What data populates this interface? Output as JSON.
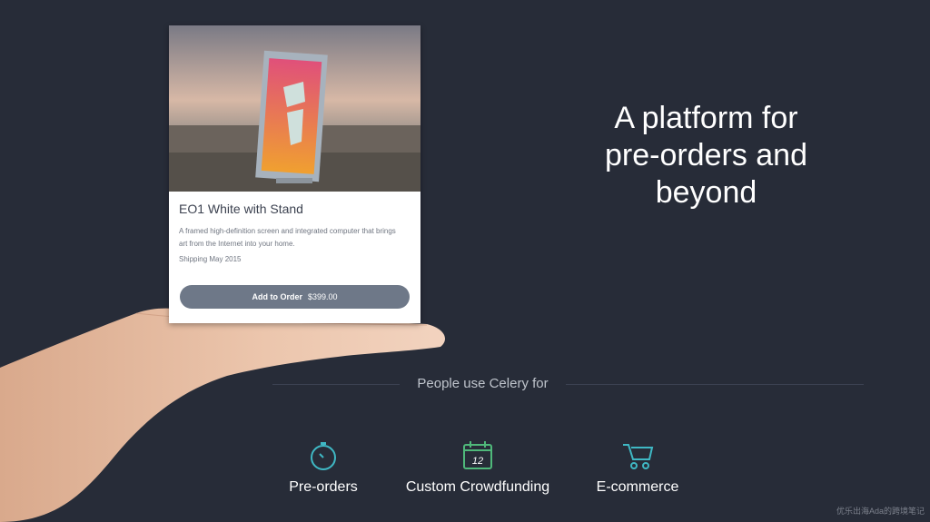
{
  "product": {
    "title": "EO1 White with Stand",
    "description": "A framed high-definition screen and integrated computer that brings art from the Internet into your home.",
    "shipping": "Shipping May 2015",
    "order_label": "Add to Order",
    "price": "$399.00"
  },
  "headline": {
    "line1": "A platform for",
    "line2": "pre-orders and",
    "line3": "beyond"
  },
  "subtitle": "People use Celery for",
  "features": [
    {
      "label": "Pre-orders",
      "icon": "stopwatch-icon",
      "color": "#3fb8c4"
    },
    {
      "label": "Custom Crowdfunding",
      "icon": "calendar-icon",
      "color": "#4fb87a",
      "icon_text": "12"
    },
    {
      "label": "E-commerce",
      "icon": "cart-icon",
      "color": "#3fb8c4"
    }
  ],
  "watermark": "优乐出海Ada的跨境笔记",
  "colors": {
    "background": "#272c38",
    "button": "#6e7888",
    "accent_teal": "#3fb8c4",
    "accent_green": "#4fb87a"
  }
}
